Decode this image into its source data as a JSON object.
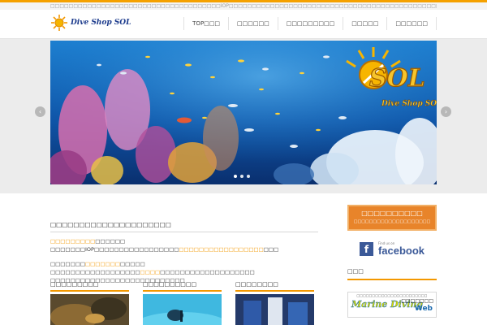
{
  "topbar": {
    "text": "□□□□□□□□□□□□□□□□□□□□□□□□□□□□□□□□□□□□□IOP□□□□□□□□□□□□□□□□□□□□□□□□□□□□□□□□□□□□□□□□□□□□□□□□□□□□□□□□□□□□□□"
  },
  "header": {
    "logo_text": "Dive Shop  SOL",
    "nav": [
      "TOP□□□",
      "□□□□□□",
      "□□□□□□□□□",
      "□□□□□",
      "□□□□□□"
    ]
  },
  "slider": {
    "logo_big": "SOL",
    "logo_sub": "Dive Shop  SOL",
    "arrow_left": "‹",
    "arrow_right": "›",
    "dots": 3,
    "active_dot": 0
  },
  "main": {
    "section_title": "□□□□□□□□□□□□□□□□□□□□□",
    "lines": [
      {
        "orange": "□□□□□□□□□",
        "rest": "□□□□□□"
      },
      {
        "pre": "□□□□□□□IOP□□□□□□□□□□□□□□□□□",
        "orange": "□□□□□□□□□□□□□□□□□",
        "rest": "□□□"
      },
      {
        "pre": "□□□□□□□",
        "orange": "□□□□□□□",
        "rest": "□□□□□"
      },
      {
        "pre": "□□□□□□□□□□□□□□□□□□",
        "orange": "□□□□",
        "rest": "□□□□□□□□□□□□□□□□□□□"
      },
      {
        "pre": "□□□□□□□□□□□□□□□□□□□□□□□□□□□"
      }
    ],
    "cards": [
      {
        "title": "□□□□□□□□□"
      },
      {
        "title": "□□□□□□□□□□"
      },
      {
        "title": "□□□□□□□□"
      }
    ]
  },
  "sidebar": {
    "contact_main": "□□□□□□□□□□",
    "contact_sub": "□□□□□□□□□□□□□□□□□□□□",
    "fb_small": "Find us on",
    "fb_word": "facebook",
    "heading": "□□□",
    "md_top": "□□□□□□□□□□□□□□□□□□□□□□□",
    "md_logo": "Marine Diving",
    "md_site": "□□□□□□□",
    "md_web": "Web",
    "reserve": "□□□□・□□□□□□□□"
  },
  "colors": {
    "accent": "#f39800",
    "contact": "#e8842a",
    "facebook": "#3b5998",
    "logo_blue": "#1b3a8c"
  }
}
